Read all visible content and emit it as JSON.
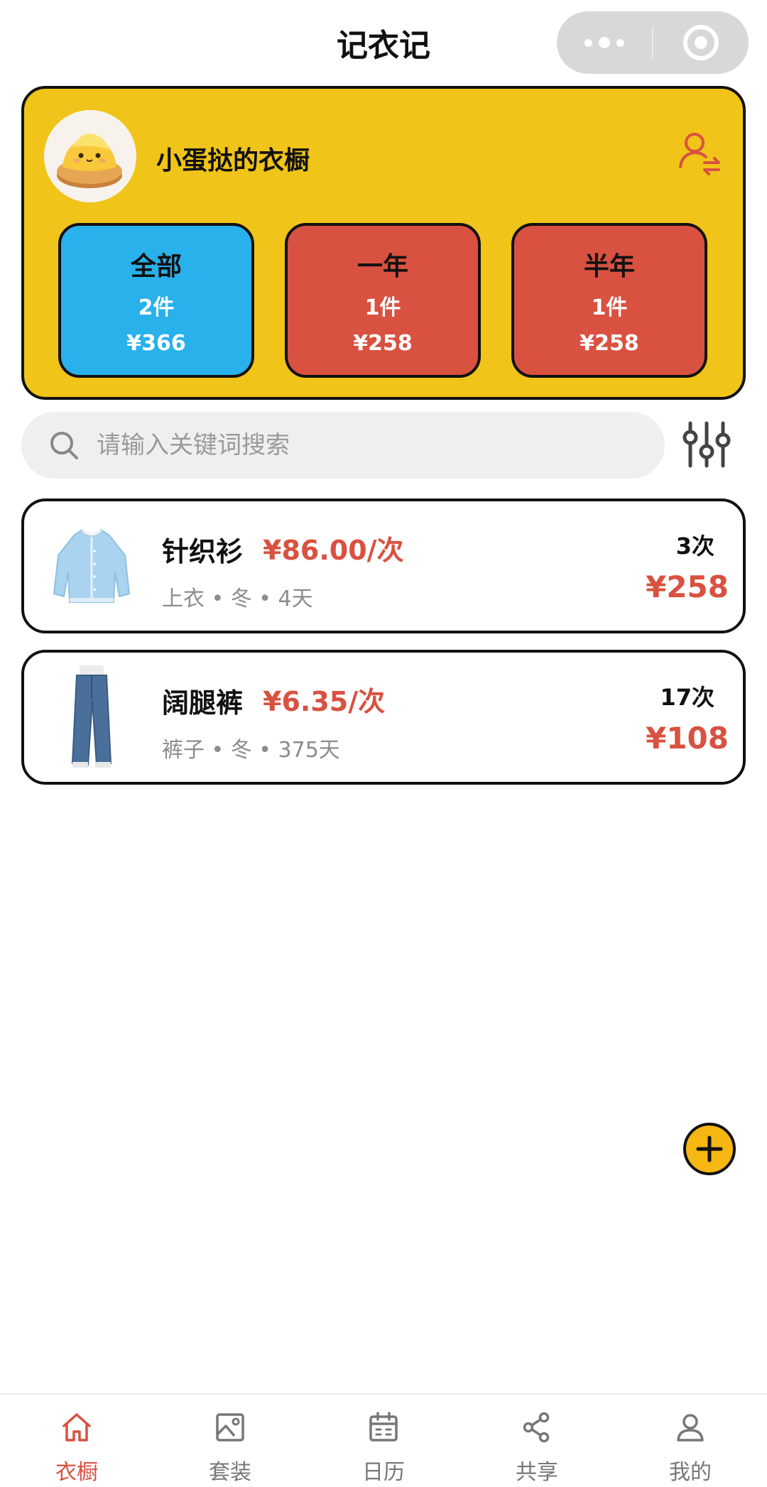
{
  "nav": {
    "title": "记衣记"
  },
  "profile": {
    "name": "小蛋挞的衣橱",
    "stats": [
      {
        "label": "全部",
        "count": "2件",
        "amount": "¥366",
        "color": "#28b1ea"
      },
      {
        "label": "一年",
        "count": "1件",
        "amount": "¥258",
        "color": "#d95140"
      },
      {
        "label": "半年",
        "count": "1件",
        "amount": "¥258",
        "color": "#d95140"
      }
    ]
  },
  "search": {
    "placeholder": "请输入关键词搜索"
  },
  "items": [
    {
      "name": "针织衫",
      "cost_per_wear": "¥86.00/次",
      "meta": "上衣 • 冬 • 4天",
      "times": "3次",
      "total": "¥258",
      "thumb_icon": "cardigan-icon"
    },
    {
      "name": "阔腿裤",
      "cost_per_wear": "¥6.35/次",
      "meta": "裤子 • 冬 • 375天",
      "times": "17次",
      "total": "¥108",
      "thumb_icon": "jeans-icon"
    }
  ],
  "tabs": [
    {
      "label": "衣橱",
      "icon": "home-icon",
      "active": true
    },
    {
      "label": "套装",
      "icon": "image-icon",
      "active": false
    },
    {
      "label": "日历",
      "icon": "calendar-icon",
      "active": false
    },
    {
      "label": "共享",
      "icon": "share-icon",
      "active": false
    },
    {
      "label": "我的",
      "icon": "user-icon",
      "active": false
    }
  ],
  "colors": {
    "accent_yellow": "#f0c419",
    "accent_red": "#d95140",
    "accent_blue": "#28b1ea"
  }
}
